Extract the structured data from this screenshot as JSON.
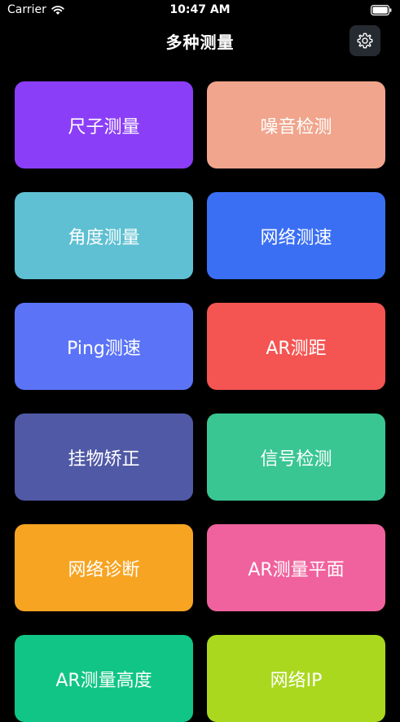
{
  "status_bar": {
    "carrier": "Carrier",
    "time": "10:47 AM"
  },
  "nav": {
    "title": "多种测量",
    "settings_icon": "gear-icon"
  },
  "colors": {
    "background": "#000000",
    "settings_button_bg": "#262a31"
  },
  "tiles": [
    {
      "label": "尺子测量",
      "color": "#8b3ef7"
    },
    {
      "label": "噪音检测",
      "color": "#f0a58c"
    },
    {
      "label": "角度测量",
      "color": "#5ec0d2"
    },
    {
      "label": "网络测速",
      "color": "#3a6ff4"
    },
    {
      "label": "Ping测速",
      "color": "#5b74f7"
    },
    {
      "label": "AR测距",
      "color": "#f45552"
    },
    {
      "label": "挂物矫正",
      "color": "#5059a5"
    },
    {
      "label": "信号检测",
      "color": "#3ac692"
    },
    {
      "label": "网络诊断",
      "color": "#f7a422"
    },
    {
      "label": "AR测量平面",
      "color": "#f0629d"
    },
    {
      "label": "AR测量高度",
      "color": "#10c586"
    },
    {
      "label": "网络IP",
      "color": "#a9d81e"
    }
  ]
}
